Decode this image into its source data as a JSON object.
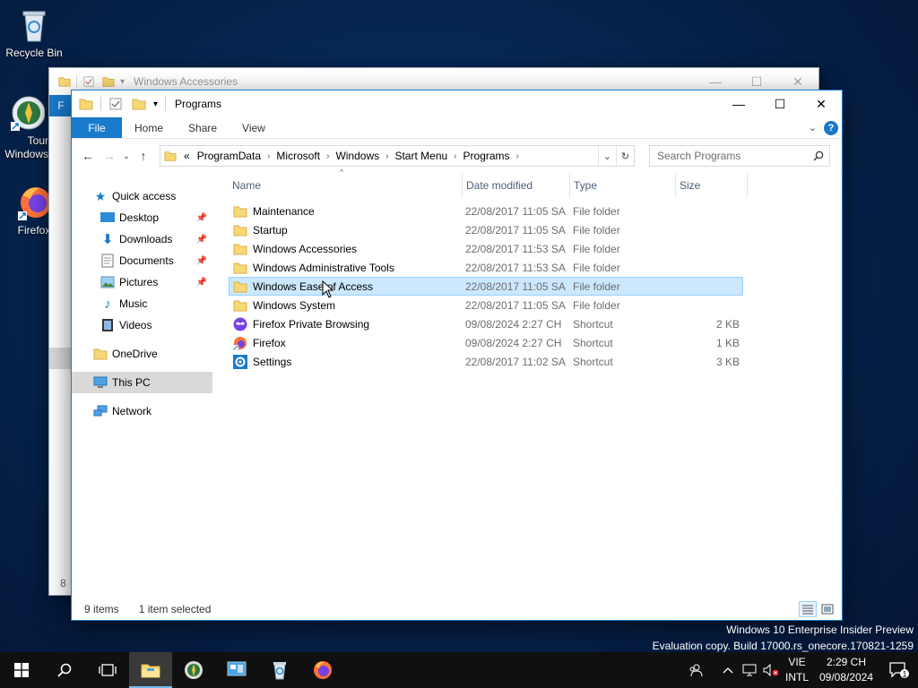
{
  "desktop": {
    "icons": [
      {
        "label": "Recycle Bin"
      },
      {
        "label": "Tour Windows"
      },
      {
        "label": "Firefox"
      }
    ]
  },
  "back_window": {
    "title": "Windows Accessories",
    "file_tab": "F",
    "status_fragment": "8"
  },
  "window": {
    "title": "Programs",
    "ribbon": {
      "file": "File",
      "home": "Home",
      "share": "Share",
      "view": "View"
    },
    "address": {
      "prefix": "«",
      "crumbs": [
        "ProgramData",
        "Microsoft",
        "Windows",
        "Start Menu",
        "Programs"
      ]
    },
    "search": {
      "placeholder": "Search Programs"
    },
    "nav": {
      "quick_access": "Quick access",
      "desktop": "Desktop",
      "downloads": "Downloads",
      "documents": "Documents",
      "pictures": "Pictures",
      "music": "Music",
      "videos": "Videos",
      "onedrive": "OneDrive",
      "this_pc": "This PC",
      "network": "Network"
    },
    "columns": {
      "name": "Name",
      "date": "Date modified",
      "type": "Type",
      "size": "Size"
    },
    "files": [
      {
        "name": "Maintenance",
        "date": "22/08/2017 11:05 SA",
        "type": "File folder",
        "size": "",
        "icon": "folder-icon"
      },
      {
        "name": "Startup",
        "date": "22/08/2017 11:05 SA",
        "type": "File folder",
        "size": "",
        "icon": "folder-icon"
      },
      {
        "name": "Windows Accessories",
        "date": "22/08/2017 11:53 SA",
        "type": "File folder",
        "size": "",
        "icon": "folder-icon"
      },
      {
        "name": "Windows Administrative Tools",
        "date": "22/08/2017 11:53 SA",
        "type": "File folder",
        "size": "",
        "icon": "folder-icon"
      },
      {
        "name": "Windows Ease of Access",
        "date": "22/08/2017 11:05 SA",
        "type": "File folder",
        "size": "",
        "icon": "folder-icon",
        "selected": true
      },
      {
        "name": "Windows System",
        "date": "22/08/2017 11:05 SA",
        "type": "File folder",
        "size": "",
        "icon": "folder-icon"
      },
      {
        "name": "Firefox Private Browsing",
        "date": "09/08/2024 2:27 CH",
        "type": "Shortcut",
        "size": "2 KB",
        "icon": "firefox-private-icon"
      },
      {
        "name": "Firefox",
        "date": "09/08/2024 2:27 CH",
        "type": "Shortcut",
        "size": "1 KB",
        "icon": "firefox-icon"
      },
      {
        "name": "Settings",
        "date": "22/08/2017 11:02 SA",
        "type": "Shortcut",
        "size": "3 KB",
        "icon": "settings-icon"
      }
    ],
    "status": {
      "count": "9 items",
      "selection": "1 item selected"
    }
  },
  "watermark": {
    "line1": "Windows 10 Enterprise Insider Preview",
    "line2": "Evaluation copy. Build 17000.rs_onecore.170821-1259"
  },
  "taskbar": {
    "lang1": "VIE",
    "lang2": "INTL",
    "time": "2:29 CH",
    "date": "09/08/2024",
    "notification_count": "1"
  },
  "colors": {
    "accent": "#1979ca",
    "selection": "#cce8ff",
    "taskbar": "#101010"
  }
}
